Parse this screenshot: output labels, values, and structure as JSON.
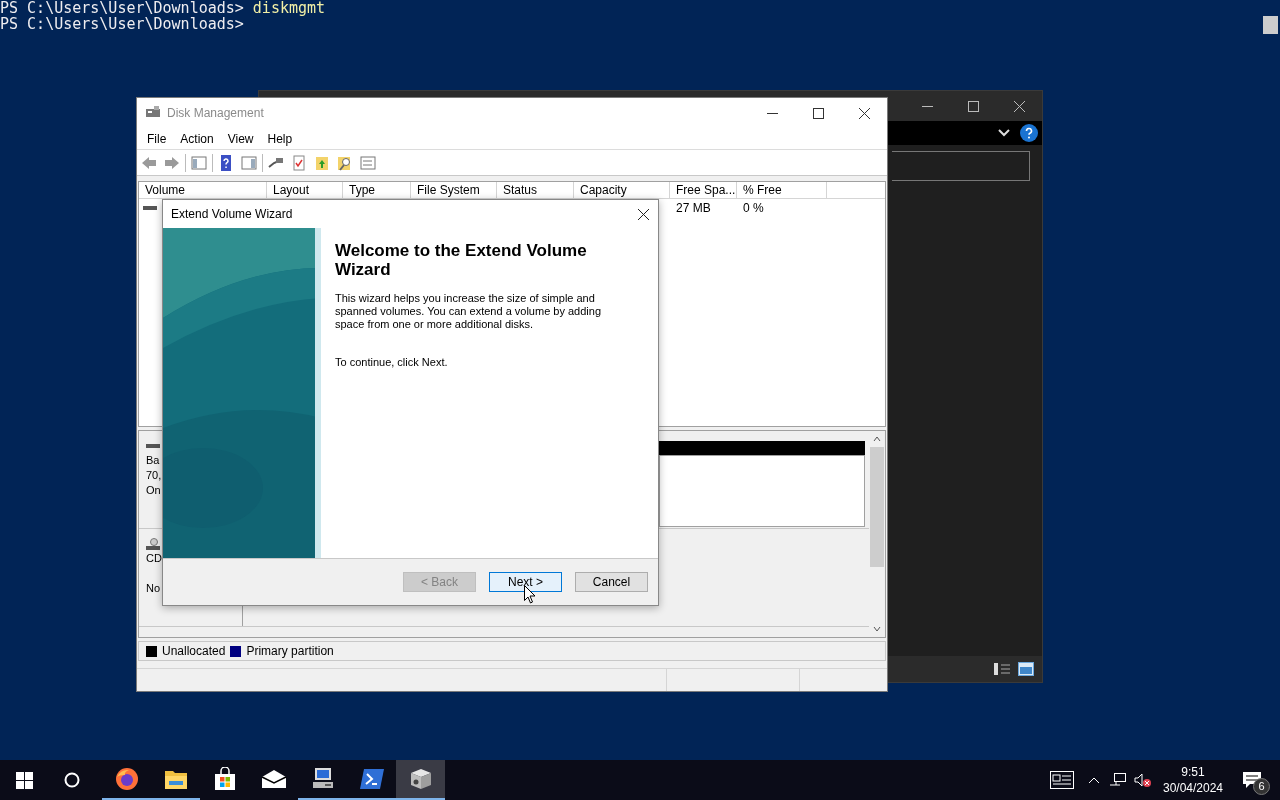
{
  "terminal": {
    "lines": [
      {
        "prompt": "PS C:\\Users\\User\\Downloads>",
        "command": "diskmgmt"
      },
      {
        "prompt": "PS C:\\Users\\User\\Downloads>"
      }
    ]
  },
  "disk_management": {
    "title": "Disk Management",
    "menu": [
      "File",
      "Action",
      "View",
      "Help"
    ],
    "table": {
      "columns": [
        "Volume",
        "Layout",
        "Type",
        "File System",
        "Status",
        "Capacity",
        "Free Spa...",
        "% Free"
      ],
      "rows": [
        {
          "free_space": "27 MB",
          "percent_free": "0 %"
        }
      ]
    },
    "disks": [
      {
        "kind": "disk",
        "label_lines": [
          "Ba",
          "70,",
          "On"
        ]
      },
      {
        "kind": "cdrom",
        "label_lines": [
          "CD",
          "No"
        ]
      }
    ],
    "legend": [
      {
        "label": "Unallocated",
        "color": "#000000"
      },
      {
        "label": "Primary partition",
        "color": "#000080"
      }
    ]
  },
  "wizard": {
    "title": "Extend Volume Wizard",
    "heading": "Welcome to the Extend Volume Wizard",
    "body": "This wizard helps you increase the size of simple and spanned volumes. You can extend a volume  by adding space from one or more additional disks.",
    "instruction": "To continue, click Next.",
    "buttons": [
      {
        "label": "< Back",
        "disabled": true,
        "focused": false
      },
      {
        "label": "Next >",
        "disabled": false,
        "focused": true
      },
      {
        "label": "Cancel",
        "disabled": false,
        "focused": false
      }
    ]
  },
  "taskbar": {
    "apps": [
      {
        "kind": "firefox",
        "running": true,
        "selected": false
      },
      {
        "kind": "folder",
        "running": true,
        "selected": false
      },
      {
        "kind": "store",
        "running": false,
        "selected": false
      },
      {
        "kind": "mail",
        "running": false,
        "selected": false
      },
      {
        "kind": "computer",
        "running": true,
        "selected": false
      },
      {
        "kind": "powershell",
        "running": true,
        "selected": false
      },
      {
        "kind": "diskmgmt",
        "running": true,
        "selected": true
      }
    ],
    "time": "9:51",
    "date": "30/04/2024",
    "notification_count": "6"
  }
}
